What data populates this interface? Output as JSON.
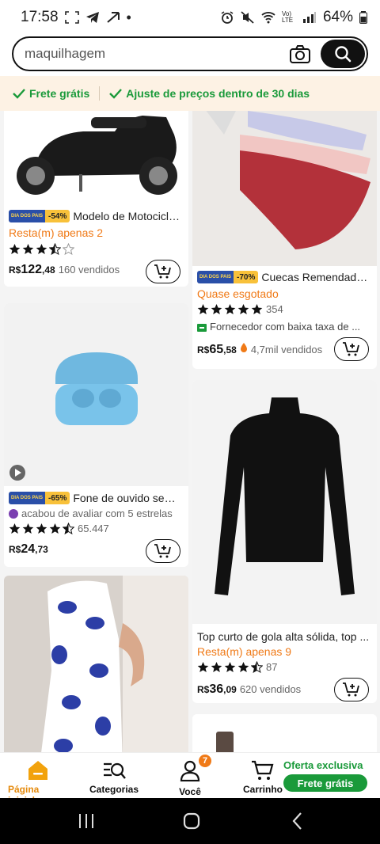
{
  "status_bar": {
    "time": "17:58",
    "battery": "64%",
    "network": "Vo) LTE"
  },
  "search": {
    "value": "maquilhagem",
    "placeholder": "maquilhagem"
  },
  "promo": {
    "item1": "Frete grátis",
    "item2": "Ajuste de preços dentro de 30 dias"
  },
  "products": [
    {
      "badge_left": "DIA DOS PAIS",
      "discount": "-54%",
      "title": "Modelo de Motociclet...",
      "stock": "Resta(m) apenas 2",
      "rating": 3.5,
      "currency": "R$",
      "price_int": "122",
      "price_dec": ",48",
      "sold": "160 vendidos"
    },
    {
      "badge_left": "DIA DOS PAIS",
      "discount": "-70%",
      "title": "Cuecas Remendadas...",
      "stock": "Quase esgotado",
      "rating": 5,
      "reviews": "354",
      "supplier": "Fornecedor com baixa taxa de ...",
      "currency": "R$",
      "price_int": "65",
      "price_dec": ",58",
      "sold": "4,7mil vendidos"
    },
    {
      "badge_left": "DIA DOS PAIS",
      "discount": "-65%",
      "title": "Fone de ouvido sem ...",
      "review_note": "acabou de avaliar com 5 estrelas",
      "rating": 4.5,
      "reviews": "65.447",
      "currency": "R$",
      "price_int": "24",
      "price_dec": ",73"
    },
    {
      "title": "Top curto de gola alta sólida, top ...",
      "stock": "Resta(m) apenas 9",
      "rating": 4.5,
      "reviews": "87",
      "currency": "R$",
      "price_int": "36",
      "price_dec": ",09",
      "sold": "620 vendidos"
    }
  ],
  "bottom_nav": {
    "home": "Página inicial",
    "categories": "Categorias",
    "you": "Você",
    "you_badge": "7",
    "cart": "Carrinho",
    "offer_title": "Oferta exclusiva",
    "offer_button": "Frete grátis"
  },
  "colors": {
    "accent_orange": "#f07a17",
    "green": "#1a9a3a",
    "promo_bg": "#fdf2e4"
  }
}
